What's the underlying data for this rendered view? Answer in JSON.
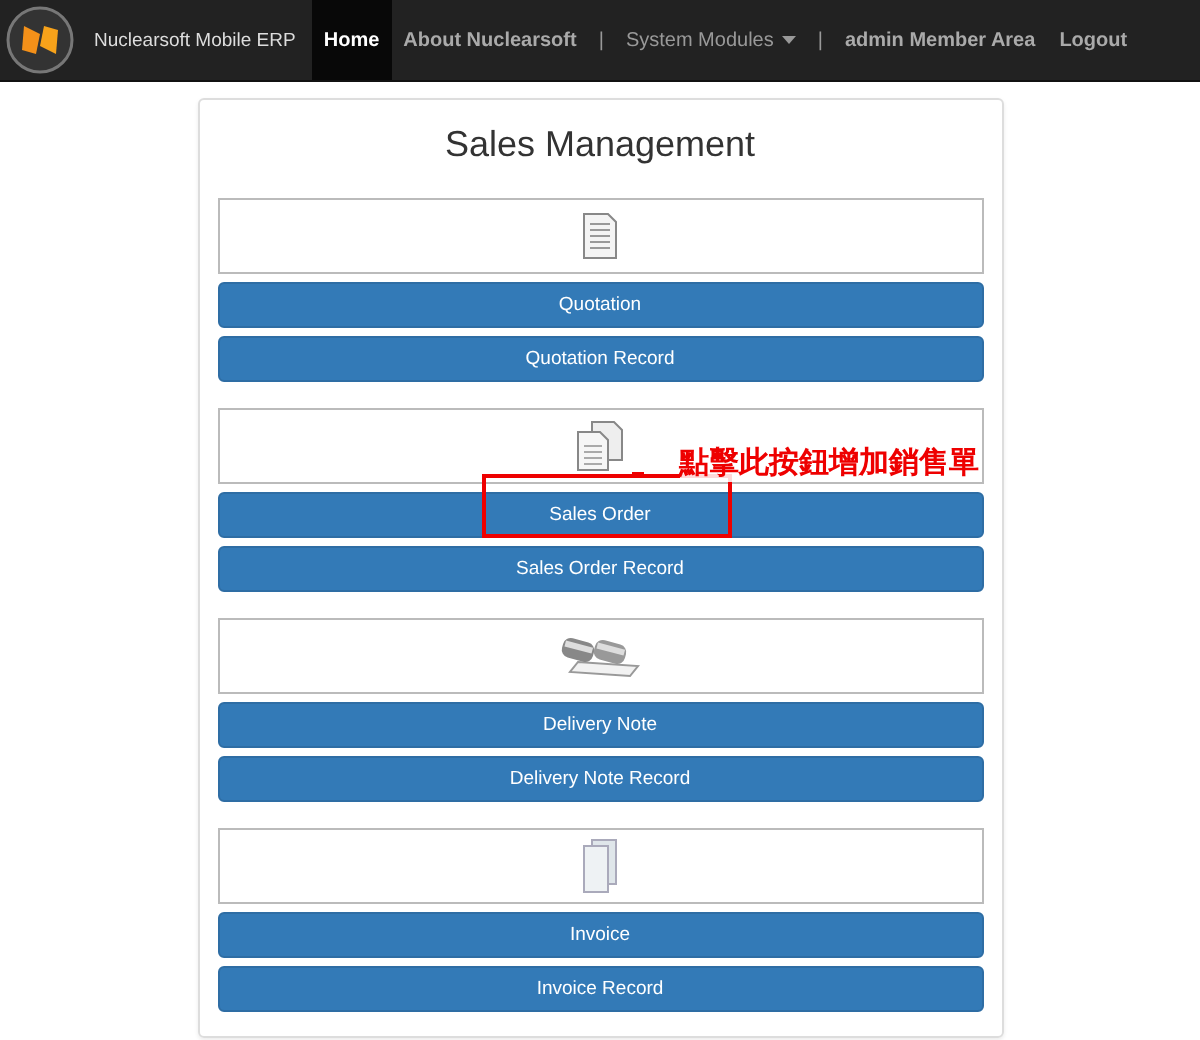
{
  "navbar": {
    "brand": "Nuclearsoft Mobile ERP",
    "items": [
      {
        "kind": "link",
        "label": "Home",
        "selected": true
      },
      {
        "kind": "link",
        "label": "About Nuclearsoft",
        "selected": false
      },
      {
        "kind": "separator",
        "label": "|"
      },
      {
        "kind": "dropdown",
        "label": "System Modules",
        "selected": false
      },
      {
        "kind": "separator",
        "label": "|"
      },
      {
        "kind": "link",
        "label": "admin Member Area",
        "selected": false
      },
      {
        "kind": "link",
        "label": "Logout",
        "selected": false
      }
    ]
  },
  "panel": {
    "title": "Sales Management",
    "sections": [
      {
        "kind": "document",
        "buttons": [
          "Quotation",
          "Quotation Record"
        ]
      },
      {
        "kind": "copies",
        "buttons": [
          "Sales Order",
          "Sales Order Record"
        ],
        "annotation": {
          "text": "點擊此按鈕增加銷售單"
        }
      },
      {
        "kind": "stamps",
        "buttons": [
          "Delivery Note",
          "Delivery Note Record"
        ]
      },
      {
        "kind": "pages",
        "buttons": [
          "Invoice",
          "Invoice Record"
        ]
      }
    ]
  }
}
